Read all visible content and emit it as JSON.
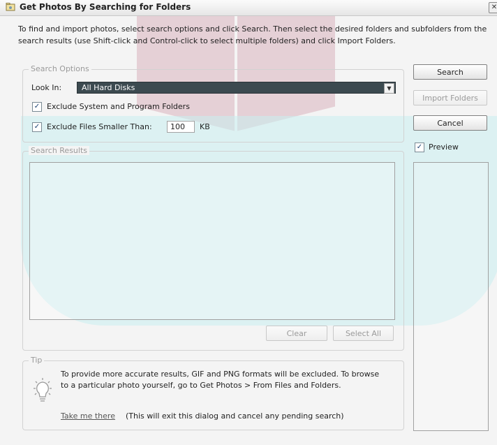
{
  "dialog": {
    "title": "Get Photos By Searching for Folders",
    "close": "✕",
    "instructions": "To find and import photos, select search options and click Search. Then select the desired folders and subfolders from the search results (use Shift-click and Control-click to select multiple folders) and click Import Folders."
  },
  "search_options": {
    "legend": "Search Options",
    "look_in_label": "Look In:",
    "look_in_value": "All Hard Disks",
    "exclude_system_label": "Exclude System and Program Folders",
    "exclude_system_checked": true,
    "exclude_small_label": "Exclude Files Smaller Than:",
    "exclude_small_checked": true,
    "min_size_value": "100",
    "min_size_unit": "KB"
  },
  "search_results": {
    "legend": "Search Results",
    "clear_label": "Clear",
    "select_all_label": "Select All"
  },
  "side_buttons": {
    "search": "Search",
    "import_folders": "Import Folders",
    "cancel": "Cancel",
    "preview_label": "Preview",
    "preview_checked": true
  },
  "tip": {
    "legend": "Tip",
    "text": "To provide more accurate results, GIF and PNG formats will be excluded. To browse to a particular photo yourself, go to Get Photos > From Files and Folders.",
    "link": "Take me there",
    "note": "(This will exit this dialog and cancel any pending search)"
  },
  "icons": {
    "title": "photo-folder-icon",
    "dropdown": "chevron-down-icon",
    "tip": "lightbulb-icon",
    "check": "check-icon"
  },
  "colors": {
    "dropdown_bg": "#3c4a50",
    "watermark_cyan": "#c9eef1",
    "watermark_pink": "#e0c4cc"
  }
}
